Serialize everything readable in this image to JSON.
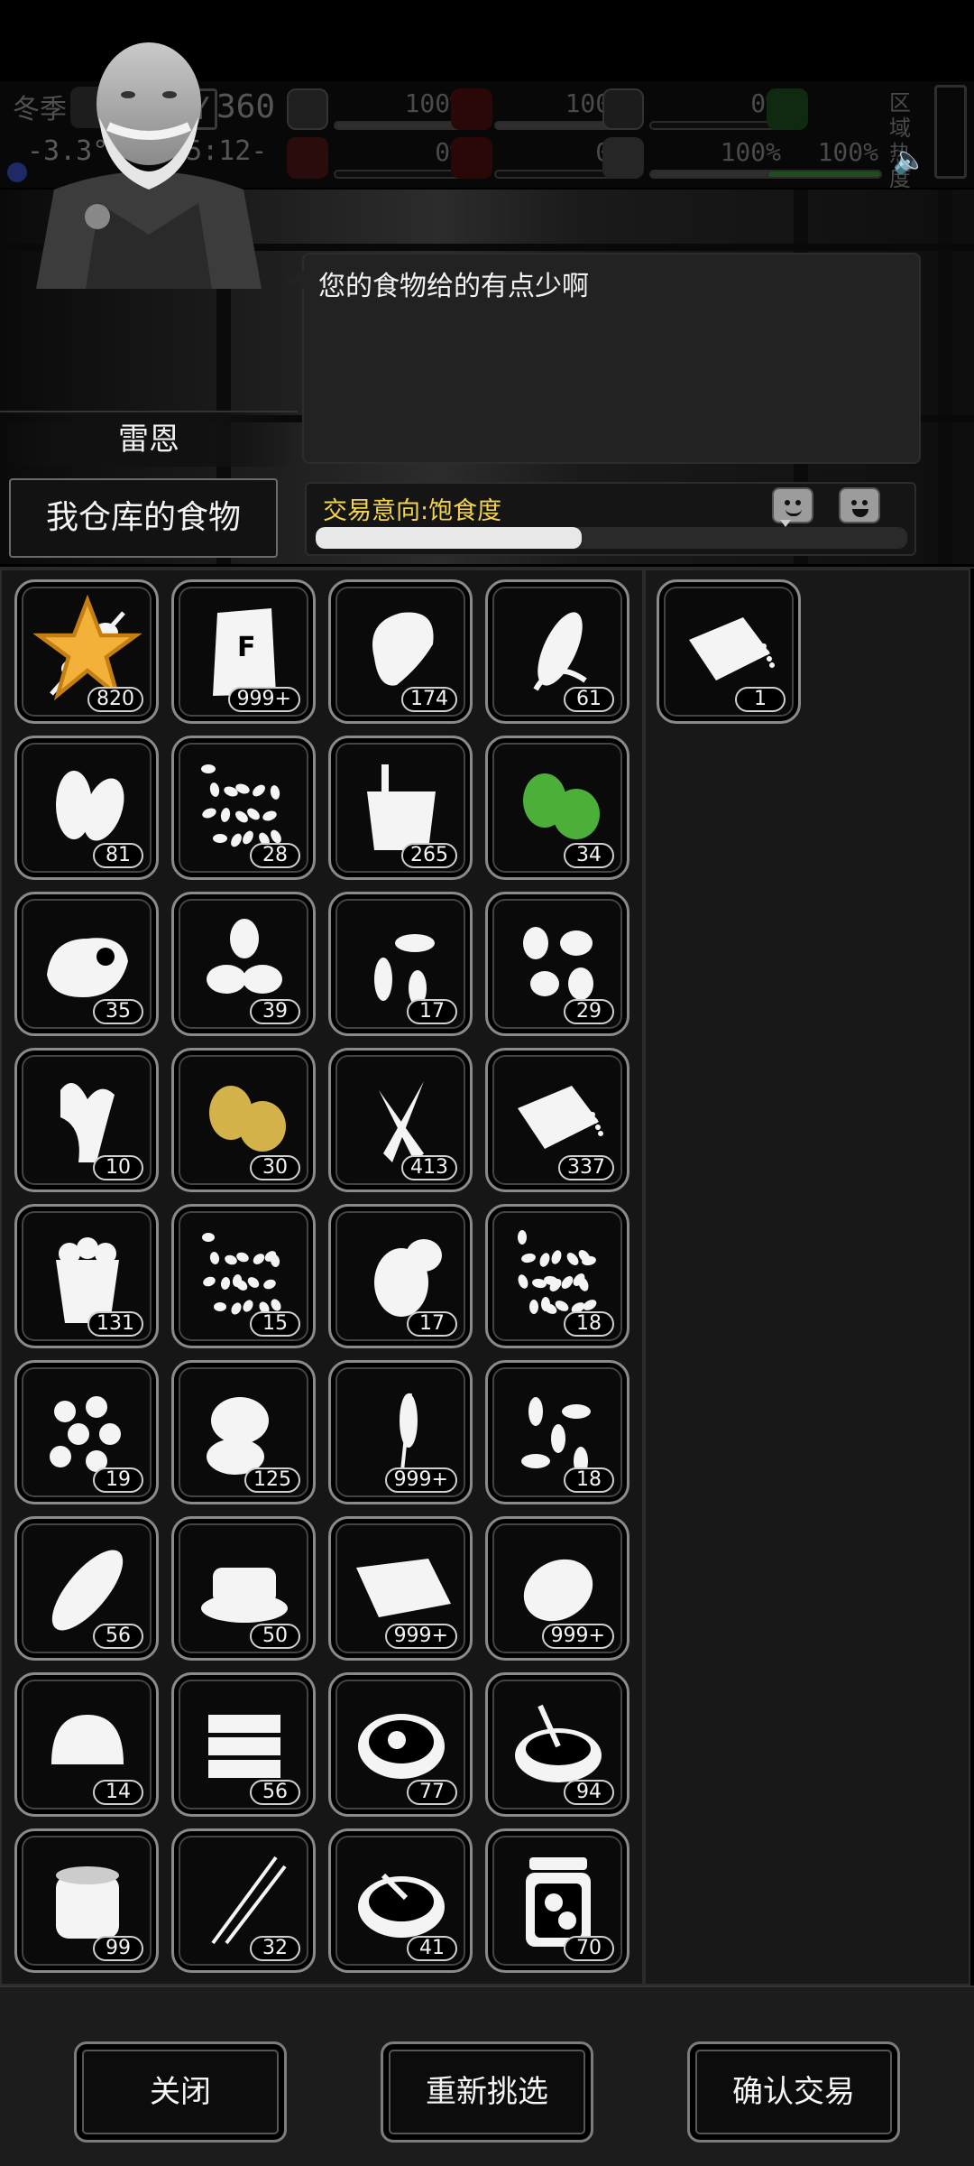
{
  "status": {
    "season": "冬季",
    "temperature": "-3.3°C",
    "day_label": "DAY",
    "day_number": "360",
    "clock": "-05:12-",
    "stats": [
      {
        "value": "100%",
        "fill": 1.0
      },
      {
        "value": "0%",
        "fill": 0.0
      },
      {
        "value": "100%",
        "fill": 1.0
      },
      {
        "value": "0%",
        "fill": 0.0
      },
      {
        "value": "0%",
        "fill": 0.0
      },
      {
        "value": "100%",
        "fill": 1.0
      },
      {
        "value": "100%",
        "fill": 1.0
      }
    ],
    "area_heat": "区域热度"
  },
  "npc": {
    "name": "雷恩",
    "dialogue": "您的食物给的有点少啊"
  },
  "storage_button": "我仓库的食物",
  "trade": {
    "label": "交易意向:饱食度",
    "progress": 0.45
  },
  "inventory": [
    {
      "icon": "skewer-icon",
      "count": "820",
      "favorite": true
    },
    {
      "icon": "flour-bag-icon",
      "count": "999+"
    },
    {
      "icon": "meat-icon",
      "count": "174"
    },
    {
      "icon": "corn-icon",
      "count": "61"
    },
    {
      "icon": "cocoa-bean-icon",
      "count": "81"
    },
    {
      "icon": "seeds-icon",
      "count": "28"
    },
    {
      "icon": "bucket-icon",
      "count": "265"
    },
    {
      "icon": "green-beans-icon",
      "count": "34"
    },
    {
      "icon": "raw-meat-icon",
      "count": "35"
    },
    {
      "icon": "nuts-icon",
      "count": "39"
    },
    {
      "icon": "sunflower-seeds-icon",
      "count": "17"
    },
    {
      "icon": "peanuts-icon",
      "count": "29"
    },
    {
      "icon": "ginger-icon",
      "count": "10"
    },
    {
      "icon": "yellow-beans-icon",
      "count": "30"
    },
    {
      "icon": "carrot-icon",
      "count": "413"
    },
    {
      "icon": "tofu-icon",
      "count": "337"
    },
    {
      "icon": "popcorn-icon",
      "count": "131"
    },
    {
      "icon": "small-beans-icon",
      "count": "15"
    },
    {
      "icon": "vegetables-icon",
      "count": "17"
    },
    {
      "icon": "rice-icon",
      "count": "18"
    },
    {
      "icon": "chickpeas-icon",
      "count": "19"
    },
    {
      "icon": "bread-rolls-icon",
      "count": "125"
    },
    {
      "icon": "wheat-icon",
      "count": "999+"
    },
    {
      "icon": "pumpkin-seeds-icon",
      "count": "18"
    },
    {
      "icon": "baguette-icon",
      "count": "56"
    },
    {
      "icon": "dish-icon",
      "count": "50"
    },
    {
      "icon": "burrito-icon",
      "count": "999+"
    },
    {
      "icon": "potato-icon",
      "count": "999+"
    },
    {
      "icon": "baked-bun-icon",
      "count": "14"
    },
    {
      "icon": "sandwich-icon",
      "count": "56"
    },
    {
      "icon": "stew-bowl-icon",
      "count": "77"
    },
    {
      "icon": "soup-bowl-icon",
      "count": "94"
    },
    {
      "icon": "canned-food-icon",
      "count": "99"
    },
    {
      "icon": "jerky-skewer-icon",
      "count": "32"
    },
    {
      "icon": "porridge-bowl-icon",
      "count": "41"
    },
    {
      "icon": "pickle-jar-icon",
      "count": "70"
    }
  ],
  "selected": [
    {
      "icon": "tofu-icon",
      "count": "1"
    }
  ],
  "buttons": {
    "close": "关闭",
    "reselect": "重新挑选",
    "confirm": "确认交易"
  }
}
